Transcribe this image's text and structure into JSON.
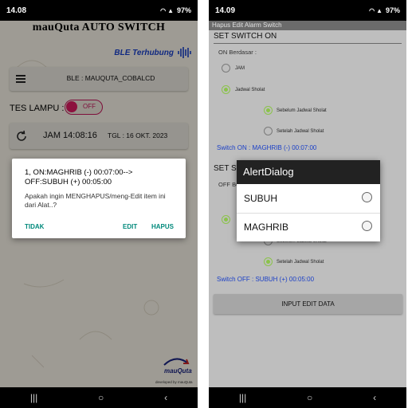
{
  "left": {
    "status": {
      "time": "14.08",
      "battery": "97%"
    },
    "app_title": "mauQuta AUTO SWITCH",
    "ble_status": "BLE Terhubung",
    "ble_device": "BLE : MAUQUTA_COBALCD",
    "tes_lampu_label": "TES LAMPU :",
    "toggle_label": "OFF",
    "jam": "JAM 14:08:16",
    "tgl": "TGL : 16 OKT. 2023",
    "dialog": {
      "title": "1, ON:MAGHRIB (-) 00:07:00--> OFF:SUBUH (+) 00:05:00",
      "message": "Apakah ingin MENGHAPUS/meng-Edit item ini dari Alat..?",
      "btn_cancel": "TIDAK",
      "btn_edit": "EDIT",
      "btn_delete": "HAPUS"
    },
    "logo_text": "mauQuta",
    "developed_by": "developed by mauQuta"
  },
  "right": {
    "status": {
      "time": "14.09",
      "battery": "97%"
    },
    "window_title": "Hapus Edit Alarm Switch",
    "set_on_header": "SET SWITCH ON",
    "on_berdasar": "ON Berdasar :",
    "opt_jam": "JAM",
    "opt_jadwal": "Jadwal Sholat",
    "opt_sebelum": "Sebelum Jadwal Sholat",
    "opt_setelah": "Setelah Jadwal Sholat",
    "switch_on_text": "Switch ON : MAGHRIB (-) 00:07:00",
    "set_off_header": "SET SWITCH OFF",
    "off_berdasar": "OFF Berdasar :",
    "switch_off_text": "Switch OFF : SUBUH (+) 00:05:00",
    "input_button": "INPUT EDIT DATA",
    "alert": {
      "title": "AlertDialog",
      "items": [
        "SUBUH",
        "MAGHRIB"
      ]
    }
  },
  "navbar": {
    "recents": "|||",
    "home": "○",
    "back": "‹"
  }
}
